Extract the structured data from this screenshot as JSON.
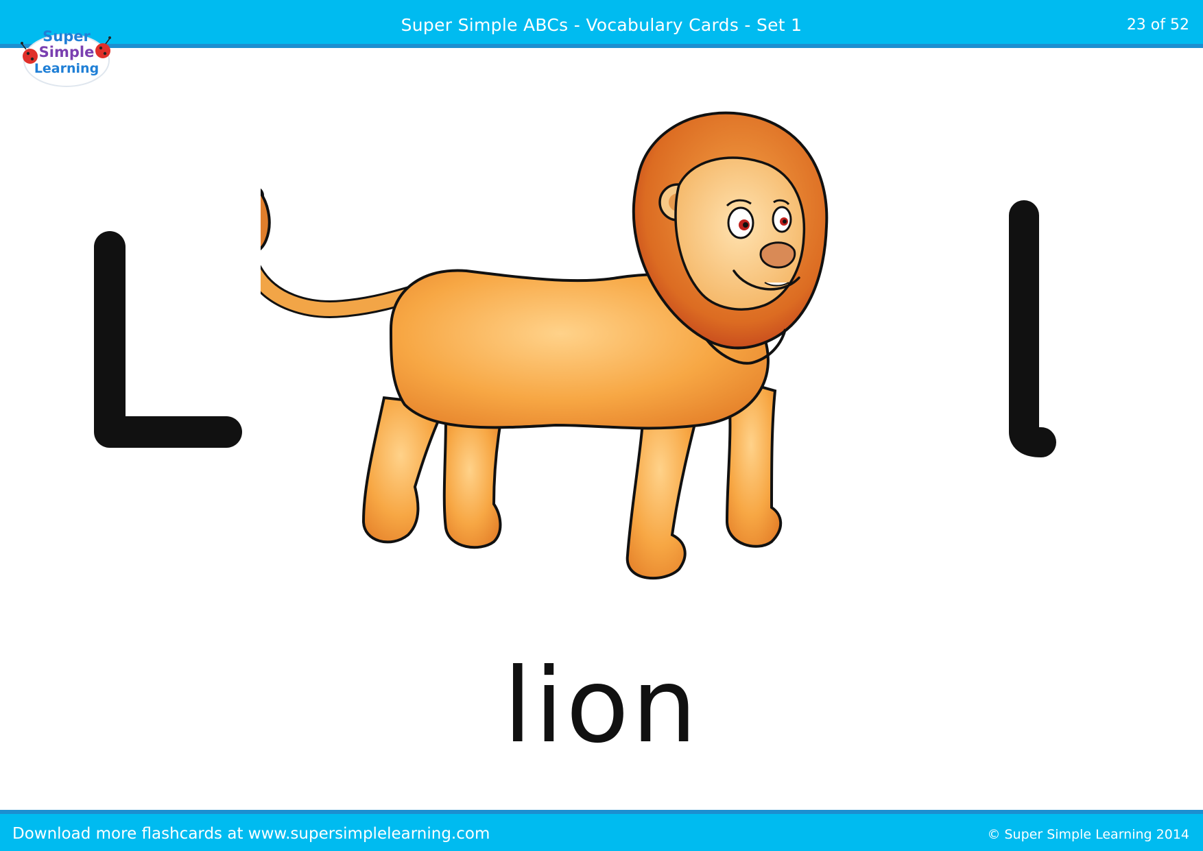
{
  "header": {
    "title": "Super Simple ABCs - Vocabulary Cards - Set 1",
    "page_indicator": "23 of 52"
  },
  "logo": {
    "line1": "Super",
    "line2": "Simple",
    "line3": "Learning"
  },
  "card": {
    "uppercase_letter": "L",
    "lowercase_letter": "l",
    "word": "lion",
    "illustration": "lion-illustration"
  },
  "footer": {
    "left": "Download more flashcards at www.supersimplelearning.com",
    "right": "© Super Simple Learning 2014"
  },
  "colors": {
    "banner": "#00bbf0",
    "banner_border": "#1c8fd0",
    "letters": "#111111",
    "lion_body": "#f4a53a",
    "lion_mane": "#d96a1c"
  }
}
